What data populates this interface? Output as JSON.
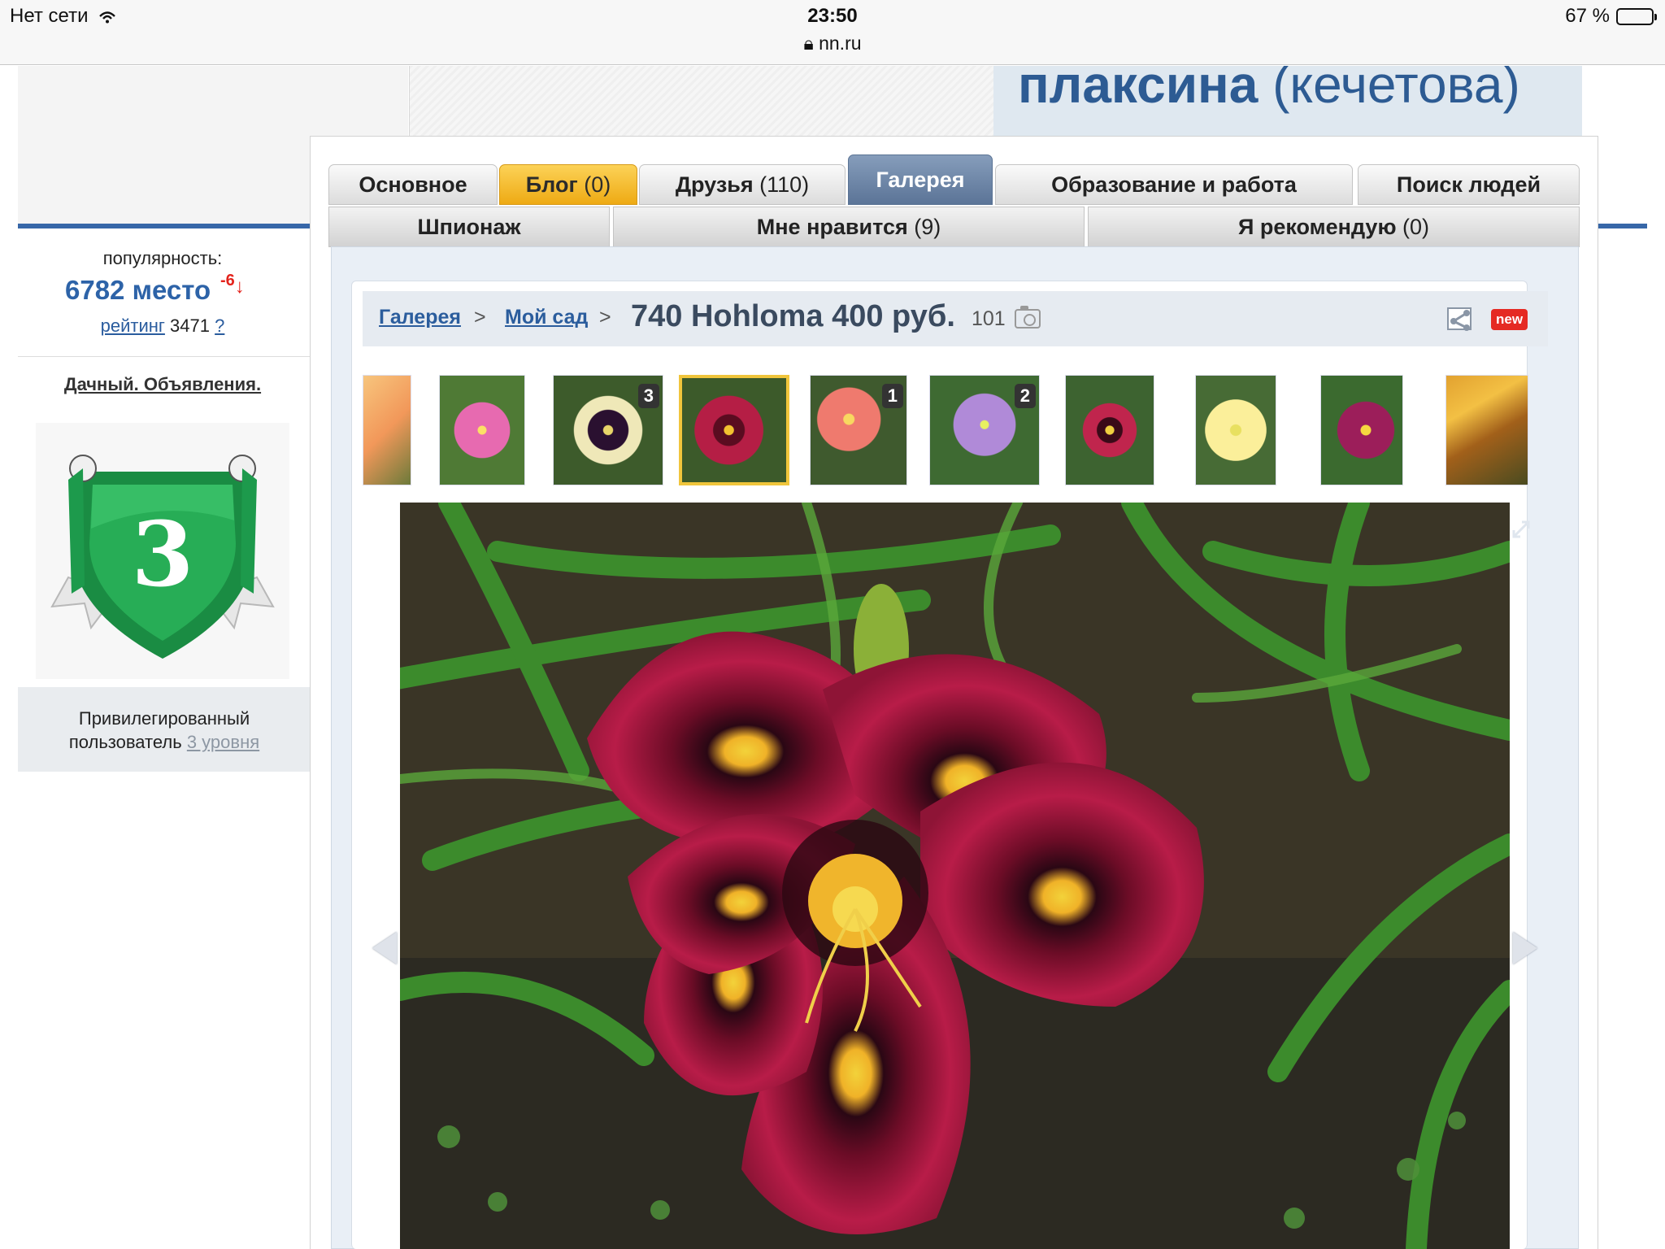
{
  "status_bar": {
    "network": "Нет сети",
    "time": "23:50",
    "url": "nn.ru",
    "battery": "67 %",
    "battery_level": 0.67
  },
  "profile": {
    "name": "плаксина",
    "maiden_name": "(кечетова)"
  },
  "tabs_row1": [
    {
      "label": "Основное",
      "count": ""
    },
    {
      "label": "Блог",
      "count": "(0)"
    },
    {
      "label": "Друзья",
      "count": "(110)"
    },
    {
      "label": "Галерея",
      "count": ""
    },
    {
      "label": "Образование и работа",
      "count": ""
    },
    {
      "label": "Поиск людей",
      "count": ""
    }
  ],
  "tabs_row2": [
    {
      "label": "Шпионаж",
      "count": ""
    },
    {
      "label": "Мне нравится",
      "count": "(9)"
    },
    {
      "label": "Я рекомендую",
      "count": "(0)"
    }
  ],
  "sidebar": {
    "popularity_label": "популярность:",
    "place": "6782 место",
    "place_delta": "-6",
    "rating_link": "рейтинг",
    "rating_value": "3471",
    "rating_help": "?",
    "section_title": "Дачный. Объявления.",
    "badge_level": "3",
    "privileged_line1": "Привилегированный",
    "privileged_line2": "пользователь",
    "privileged_link": "3 уровня"
  },
  "breadcrumb": {
    "gallery": "Галерея",
    "album": "Мой сад",
    "separator": ">"
  },
  "photo": {
    "title": "740 Hohloma 400 руб.",
    "count": "101",
    "new_badge": "new"
  },
  "thumbnails": [
    {
      "badge": ""
    },
    {
      "badge": ""
    },
    {
      "badge": "3"
    },
    {
      "badge": ""
    },
    {
      "badge": "1"
    },
    {
      "badge": "2"
    },
    {
      "badge": ""
    },
    {
      "badge": ""
    },
    {
      "badge": ""
    },
    {
      "badge": ""
    }
  ],
  "colors": {
    "accent_blue": "#3767a8",
    "blog_tab": "#f2b526",
    "active_tab": "#6d84a6",
    "new_badge": "#e52a23"
  }
}
